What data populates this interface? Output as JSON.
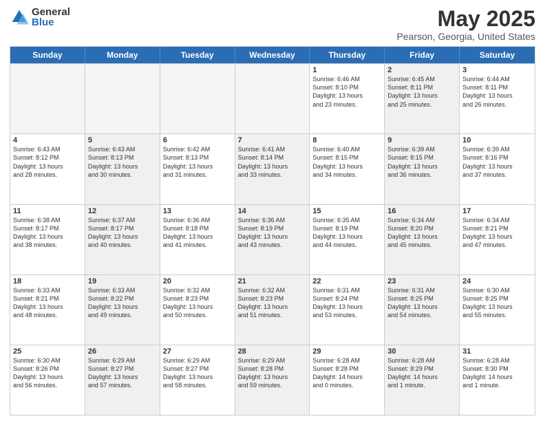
{
  "logo": {
    "general": "General",
    "blue": "Blue"
  },
  "title": {
    "month": "May 2025",
    "location": "Pearson, Georgia, United States"
  },
  "weekdays": [
    "Sunday",
    "Monday",
    "Tuesday",
    "Wednesday",
    "Thursday",
    "Friday",
    "Saturday"
  ],
  "rows": [
    [
      {
        "day": "",
        "info": "",
        "empty": true
      },
      {
        "day": "",
        "info": "",
        "empty": true
      },
      {
        "day": "",
        "info": "",
        "empty": true
      },
      {
        "day": "",
        "info": "",
        "empty": true
      },
      {
        "day": "1",
        "info": "Sunrise: 6:46 AM\nSunset: 8:10 PM\nDaylight: 13 hours\nand 23 minutes.",
        "empty": false
      },
      {
        "day": "2",
        "info": "Sunrise: 6:45 AM\nSunset: 8:11 PM\nDaylight: 13 hours\nand 25 minutes.",
        "empty": false,
        "shaded": true
      },
      {
        "day": "3",
        "info": "Sunrise: 6:44 AM\nSunset: 8:11 PM\nDaylight: 13 hours\nand 26 minutes.",
        "empty": false
      }
    ],
    [
      {
        "day": "4",
        "info": "Sunrise: 6:43 AM\nSunset: 8:12 PM\nDaylight: 13 hours\nand 28 minutes.",
        "empty": false
      },
      {
        "day": "5",
        "info": "Sunrise: 6:43 AM\nSunset: 8:13 PM\nDaylight: 13 hours\nand 30 minutes.",
        "empty": false,
        "shaded": true
      },
      {
        "day": "6",
        "info": "Sunrise: 6:42 AM\nSunset: 8:13 PM\nDaylight: 13 hours\nand 31 minutes.",
        "empty": false
      },
      {
        "day": "7",
        "info": "Sunrise: 6:41 AM\nSunset: 8:14 PM\nDaylight: 13 hours\nand 33 minutes.",
        "empty": false,
        "shaded": true
      },
      {
        "day": "8",
        "info": "Sunrise: 6:40 AM\nSunset: 8:15 PM\nDaylight: 13 hours\nand 34 minutes.",
        "empty": false
      },
      {
        "day": "9",
        "info": "Sunrise: 6:39 AM\nSunset: 8:15 PM\nDaylight: 13 hours\nand 36 minutes.",
        "empty": false,
        "shaded": true
      },
      {
        "day": "10",
        "info": "Sunrise: 6:39 AM\nSunset: 8:16 PM\nDaylight: 13 hours\nand 37 minutes.",
        "empty": false
      }
    ],
    [
      {
        "day": "11",
        "info": "Sunrise: 6:38 AM\nSunset: 8:17 PM\nDaylight: 13 hours\nand 38 minutes.",
        "empty": false
      },
      {
        "day": "12",
        "info": "Sunrise: 6:37 AM\nSunset: 8:17 PM\nDaylight: 13 hours\nand 40 minutes.",
        "empty": false,
        "shaded": true
      },
      {
        "day": "13",
        "info": "Sunrise: 6:36 AM\nSunset: 8:18 PM\nDaylight: 13 hours\nand 41 minutes.",
        "empty": false
      },
      {
        "day": "14",
        "info": "Sunrise: 6:36 AM\nSunset: 8:19 PM\nDaylight: 13 hours\nand 43 minutes.",
        "empty": false,
        "shaded": true
      },
      {
        "day": "15",
        "info": "Sunrise: 6:35 AM\nSunset: 8:19 PM\nDaylight: 13 hours\nand 44 minutes.",
        "empty": false
      },
      {
        "day": "16",
        "info": "Sunrise: 6:34 AM\nSunset: 8:20 PM\nDaylight: 13 hours\nand 45 minutes.",
        "empty": false,
        "shaded": true
      },
      {
        "day": "17",
        "info": "Sunrise: 6:34 AM\nSunset: 8:21 PM\nDaylight: 13 hours\nand 47 minutes.",
        "empty": false
      }
    ],
    [
      {
        "day": "18",
        "info": "Sunrise: 6:33 AM\nSunset: 8:21 PM\nDaylight: 13 hours\nand 48 minutes.",
        "empty": false
      },
      {
        "day": "19",
        "info": "Sunrise: 6:33 AM\nSunset: 8:22 PM\nDaylight: 13 hours\nand 49 minutes.",
        "empty": false,
        "shaded": true
      },
      {
        "day": "20",
        "info": "Sunrise: 6:32 AM\nSunset: 8:23 PM\nDaylight: 13 hours\nand 50 minutes.",
        "empty": false
      },
      {
        "day": "21",
        "info": "Sunrise: 6:32 AM\nSunset: 8:23 PM\nDaylight: 13 hours\nand 51 minutes.",
        "empty": false,
        "shaded": true
      },
      {
        "day": "22",
        "info": "Sunrise: 6:31 AM\nSunset: 8:24 PM\nDaylight: 13 hours\nand 53 minutes.",
        "empty": false
      },
      {
        "day": "23",
        "info": "Sunrise: 6:31 AM\nSunset: 8:25 PM\nDaylight: 13 hours\nand 54 minutes.",
        "empty": false,
        "shaded": true
      },
      {
        "day": "24",
        "info": "Sunrise: 6:30 AM\nSunset: 8:25 PM\nDaylight: 13 hours\nand 55 minutes.",
        "empty": false
      }
    ],
    [
      {
        "day": "25",
        "info": "Sunrise: 6:30 AM\nSunset: 8:26 PM\nDaylight: 13 hours\nand 56 minutes.",
        "empty": false
      },
      {
        "day": "26",
        "info": "Sunrise: 6:29 AM\nSunset: 8:27 PM\nDaylight: 13 hours\nand 57 minutes.",
        "empty": false,
        "shaded": true
      },
      {
        "day": "27",
        "info": "Sunrise: 6:29 AM\nSunset: 8:27 PM\nDaylight: 13 hours\nand 58 minutes.",
        "empty": false
      },
      {
        "day": "28",
        "info": "Sunrise: 6:29 AM\nSunset: 8:28 PM\nDaylight: 13 hours\nand 59 minutes.",
        "empty": false,
        "shaded": true
      },
      {
        "day": "29",
        "info": "Sunrise: 6:28 AM\nSunset: 8:28 PM\nDaylight: 14 hours\nand 0 minutes.",
        "empty": false
      },
      {
        "day": "30",
        "info": "Sunrise: 6:28 AM\nSunset: 8:29 PM\nDaylight: 14 hours\nand 1 minute.",
        "empty": false,
        "shaded": true
      },
      {
        "day": "31",
        "info": "Sunrise: 6:28 AM\nSunset: 8:30 PM\nDaylight: 14 hours\nand 1 minute.",
        "empty": false
      }
    ]
  ]
}
